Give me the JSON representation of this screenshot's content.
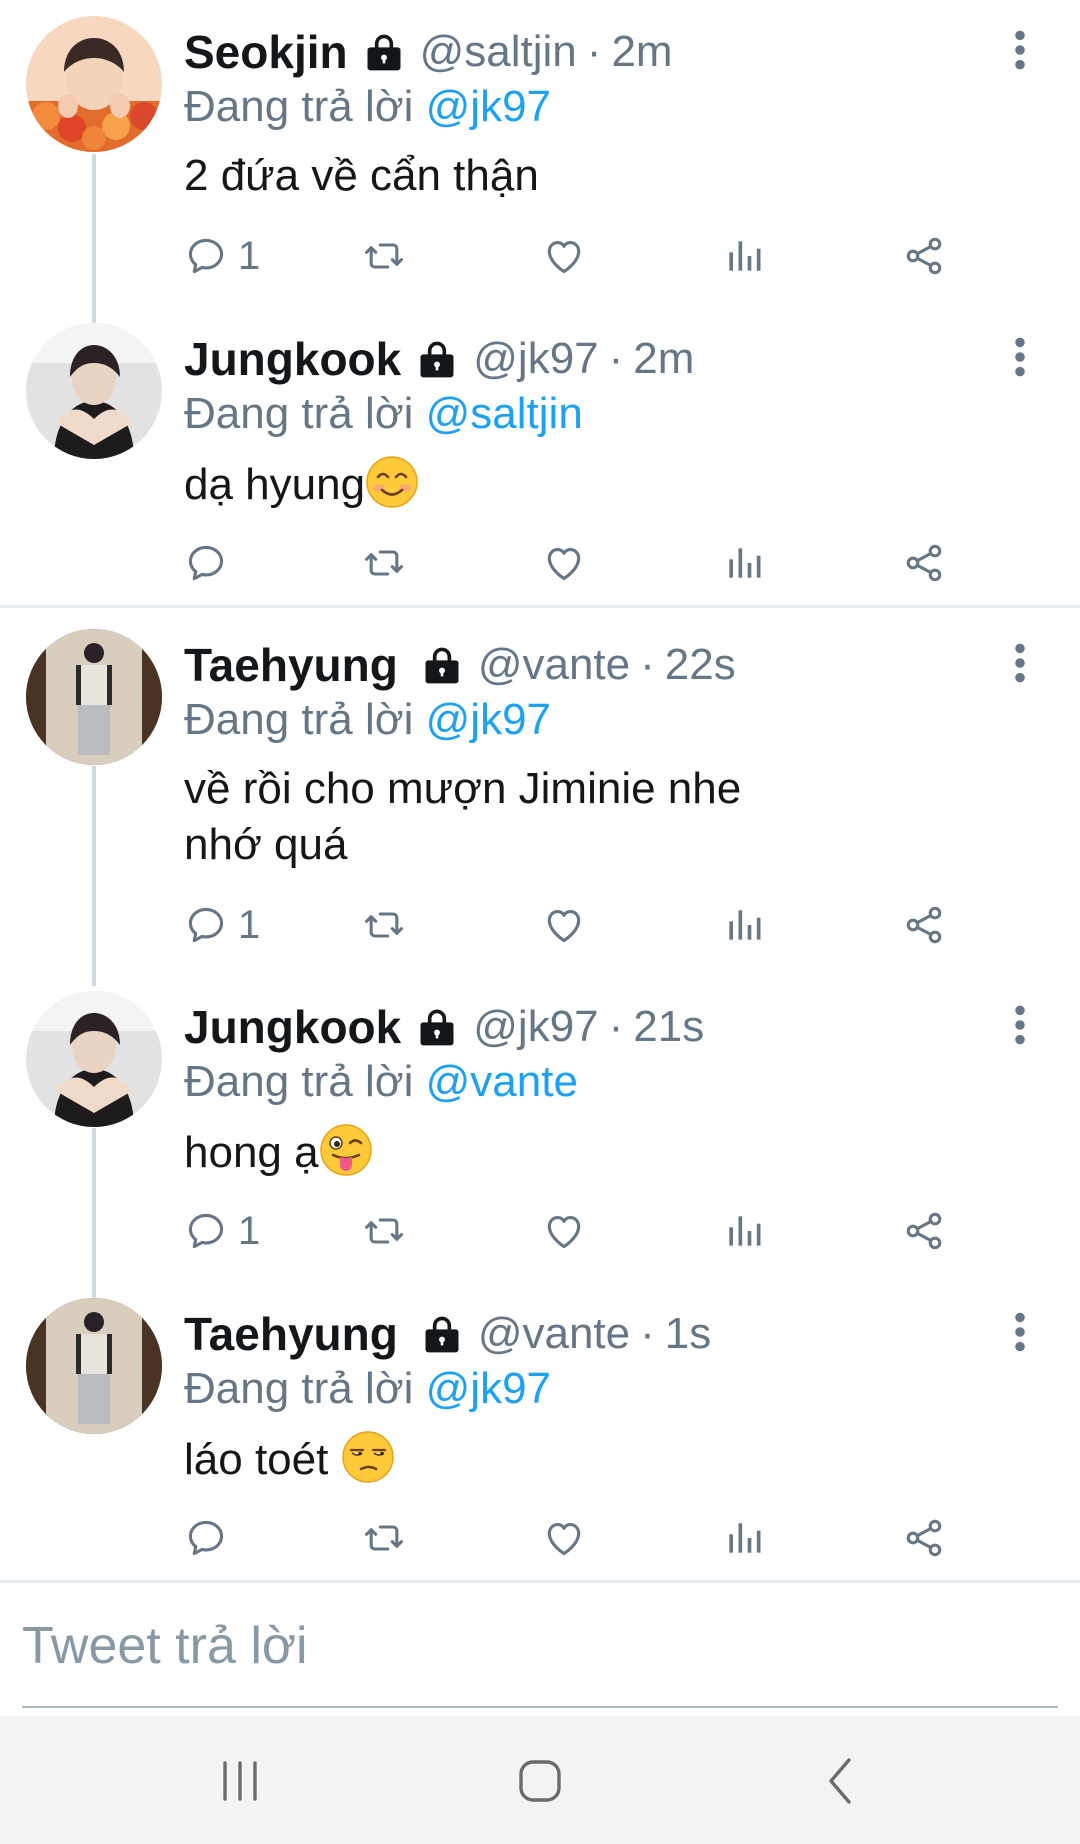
{
  "replying_prefix": "Đang trả lời",
  "tweets": [
    {
      "name": "Seokjin",
      "handle": "@saltjin",
      "separator": "·",
      "time": "2m",
      "reply_to": "@jk97",
      "text": "2 đứa về cẩn thận",
      "reply_count": "1"
    },
    {
      "name": "Jungkook",
      "handle": "@jk97",
      "separator": "·",
      "time": "2m",
      "reply_to": "@saltjin",
      "text": "dạ hyung",
      "text_emoji": "smiling-face-icon",
      "reply_count": ""
    },
    {
      "name": "Taehyung",
      "handle": "@vante",
      "separator": "·",
      "time": "22s",
      "reply_to": "@jk97",
      "text_line1": "về rồi cho mượn Jiminie nhe",
      "text_line2": "nhớ quá",
      "reply_count": "1"
    },
    {
      "name": "Jungkook",
      "handle": "@jk97",
      "separator": "·",
      "time": "21s",
      "reply_to": "@vante",
      "text": "hong ạ",
      "text_emoji": "winking-tongue-face-icon",
      "reply_count": "1"
    },
    {
      "name": "Taehyung",
      "handle": "@vante",
      "separator": "·",
      "time": "1s",
      "reply_to": "@jk97",
      "text": "láo toét ",
      "text_emoji": "unamused-face-icon",
      "reply_count": ""
    }
  ],
  "reply_box": {
    "placeholder": "Tweet trả lời"
  },
  "colors": {
    "accent": "#1da1f2",
    "secondary_text": "#657786",
    "primary_text": "#14171a",
    "divider": "#e6ecf0"
  },
  "icons": [
    "reply-icon",
    "retweet-icon",
    "like-icon",
    "analytics-icon",
    "share-icon",
    "more-vertical-icon",
    "lock-icon"
  ],
  "navbar": {
    "buttons": [
      "recent-apps-button",
      "home-button",
      "back-button"
    ]
  }
}
